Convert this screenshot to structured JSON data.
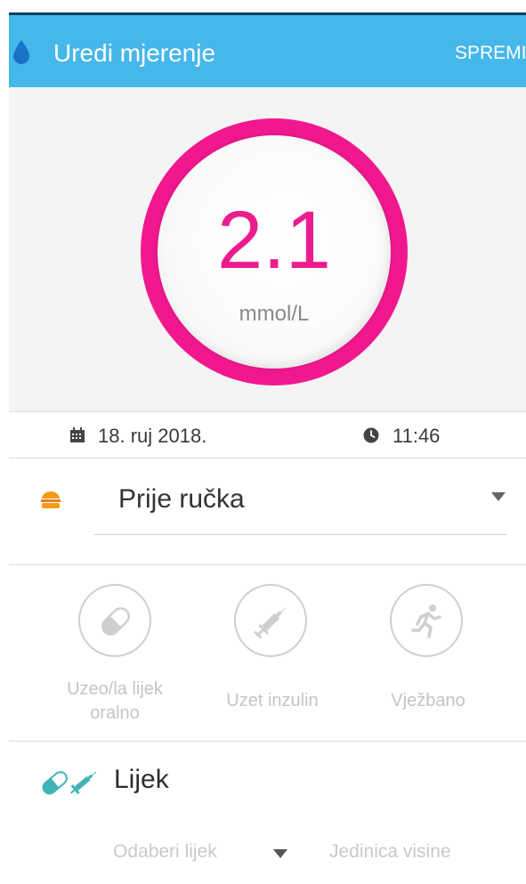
{
  "header": {
    "title": "Uredi mjerenje",
    "save_label": "SPREMI",
    "background_color": "#45b7ea",
    "icon": "water-drop-icon"
  },
  "measurement": {
    "value": "2.1",
    "unit": "mmol/L",
    "ring_color": "#f1188f"
  },
  "date_time": {
    "date": "18. ruj 2018.",
    "time": "11:46",
    "date_icon": "calendar-icon",
    "time_icon": "clock-icon"
  },
  "meal": {
    "selected": "Prije ručka",
    "icon": "burger-icon"
  },
  "activities": [
    {
      "label": "Uzeo/la lijek oralno",
      "icon": "pill-icon"
    },
    {
      "label": "Uzet inzulin",
      "icon": "syringe-icon"
    },
    {
      "label": "Vježbano",
      "icon": "running-person-icon"
    }
  ],
  "medication": {
    "title": "Lijek",
    "select_placeholder": "Odaberi lijek",
    "unit_placeholder": "Jedinica visine",
    "icons": [
      "pill-icon",
      "syringe-icon"
    ],
    "accent_color": "#3fb3b5"
  }
}
